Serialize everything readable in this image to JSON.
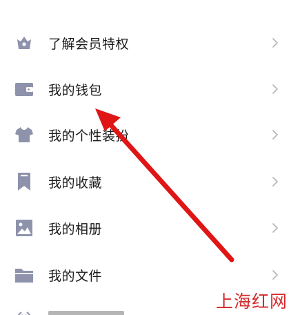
{
  "menu": {
    "items": [
      {
        "label": "了解会员特权",
        "icon": "crown-gem-icon"
      },
      {
        "label": "我的钱包",
        "icon": "wallet-icon"
      },
      {
        "label": "我的个性装扮",
        "icon": "tshirt-icon"
      },
      {
        "label": "我的收藏",
        "icon": "bookmark-icon"
      },
      {
        "label": "我的相册",
        "icon": "photo-icon"
      },
      {
        "label": "我的文件",
        "icon": "folder-icon"
      }
    ],
    "partial_item": {
      "icon": "broadcast-icon"
    },
    "chevron_icon": "chevron-right-icon"
  },
  "colors": {
    "icon": "#8E93AB",
    "chevron": "#b5b5b5",
    "arrow": "#e01515",
    "watermark": "#d42a2a"
  },
  "watermark": {
    "text": "上海红网"
  }
}
